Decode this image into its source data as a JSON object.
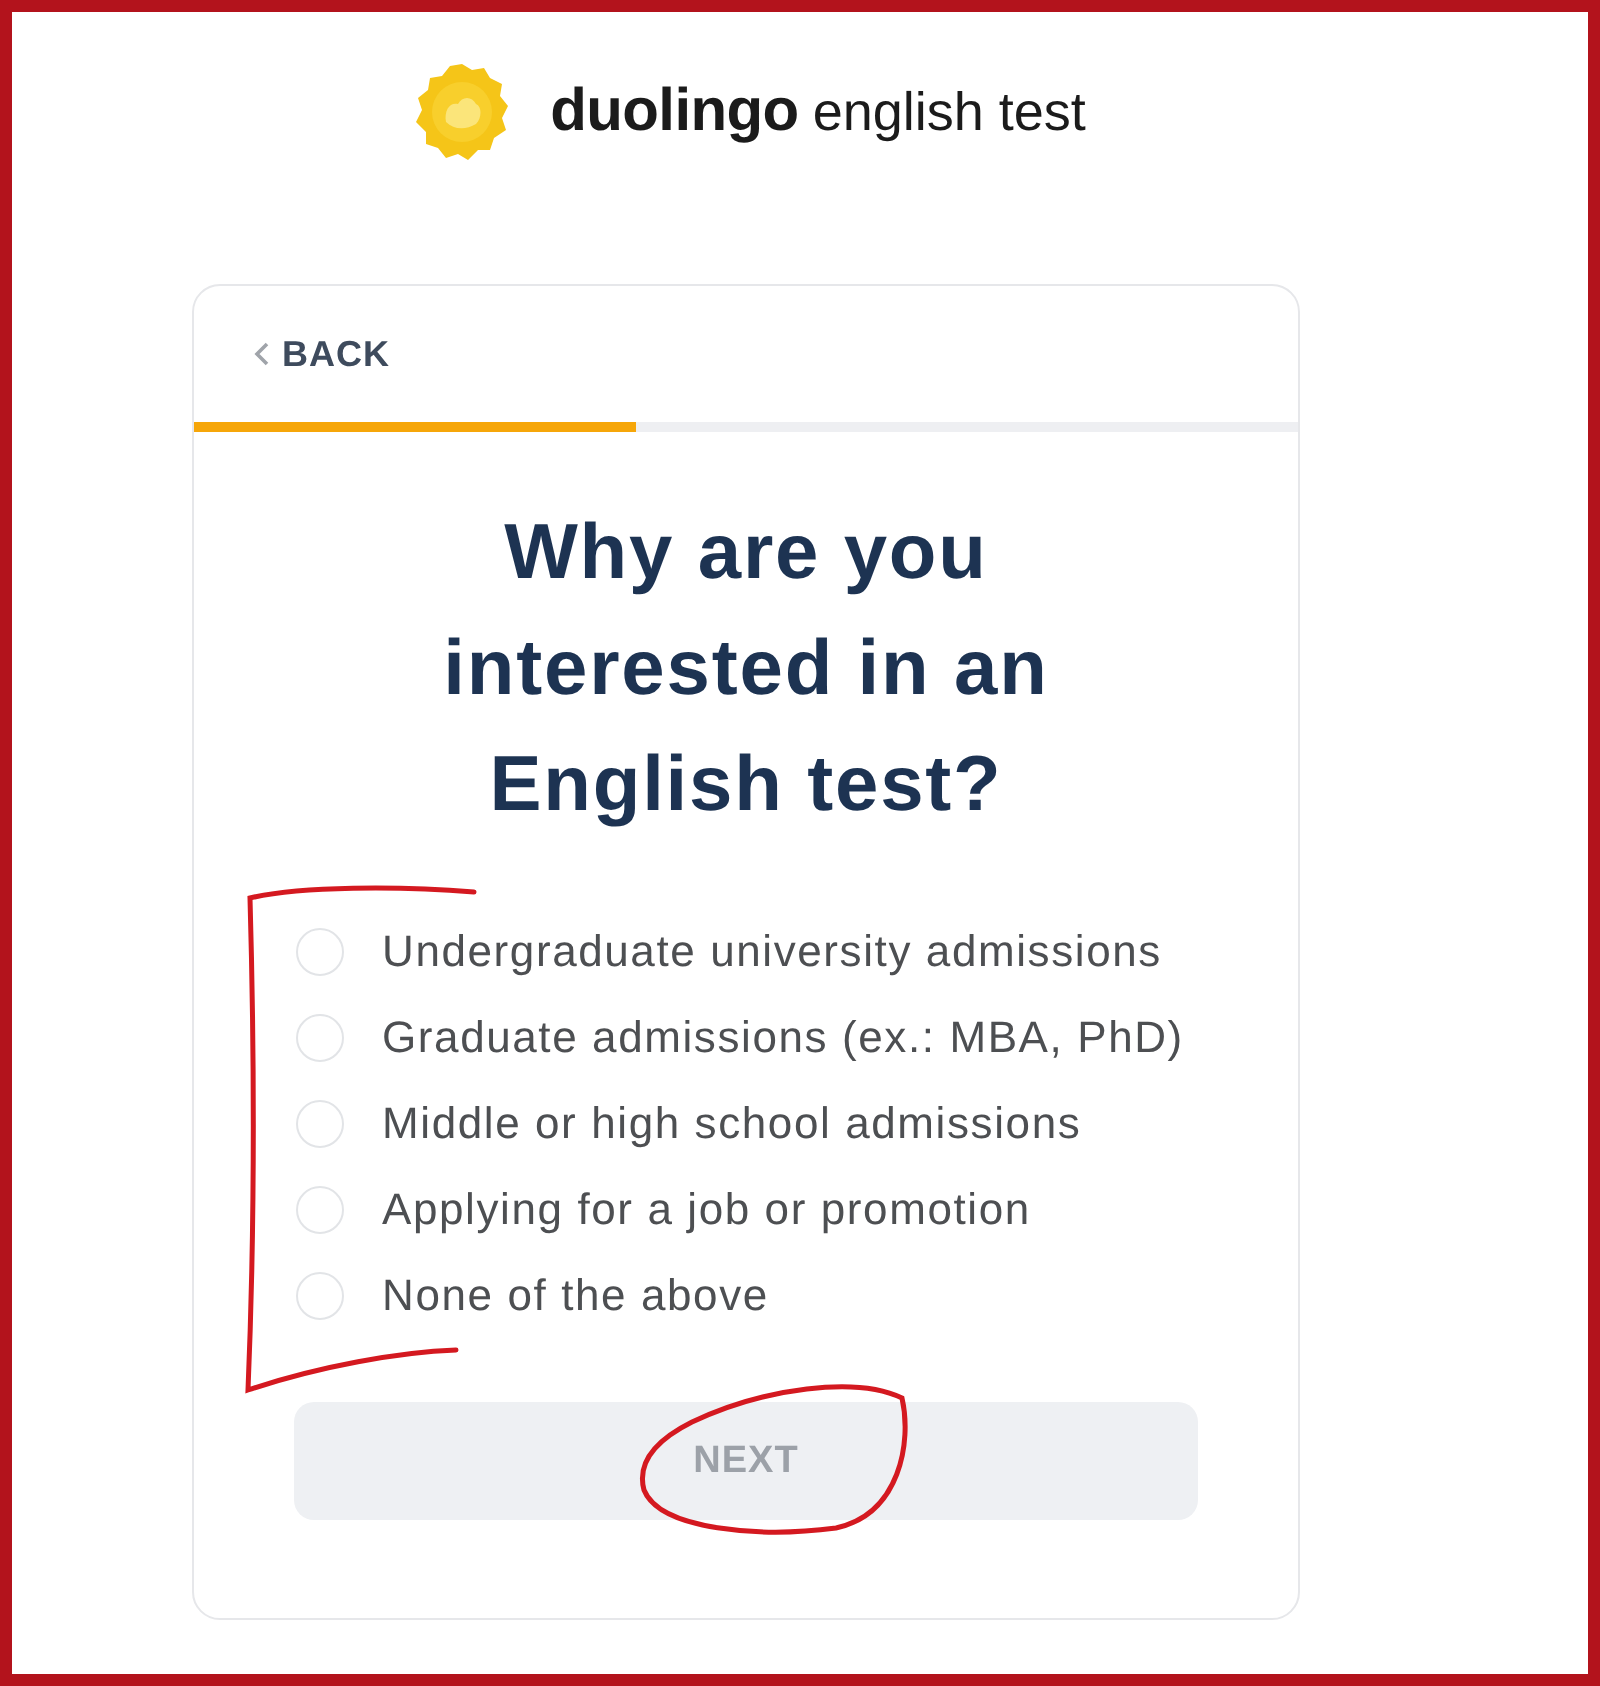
{
  "logo": {
    "brand": "duolingo",
    "product": "english test"
  },
  "card": {
    "back": {
      "label": "BACK"
    },
    "progress": {
      "level": 0.4
    },
    "question": "Why are you interested in an English test?",
    "options_bracketed": true,
    "options": [
      {
        "label": "Undergraduate university admissions",
        "selected": false
      },
      {
        "label": "Graduate admissions (ex.: MBA, PhD)",
        "selected": false
      },
      {
        "label": "Middle or high school admissions",
        "selected": false
      },
      {
        "label": "Applying for a job or promotion",
        "selected": false
      },
      {
        "label": "None of the above",
        "selected": false
      }
    ],
    "next_button": {
      "label": "NEXT",
      "disabled": true,
      "circled": true
    }
  }
}
